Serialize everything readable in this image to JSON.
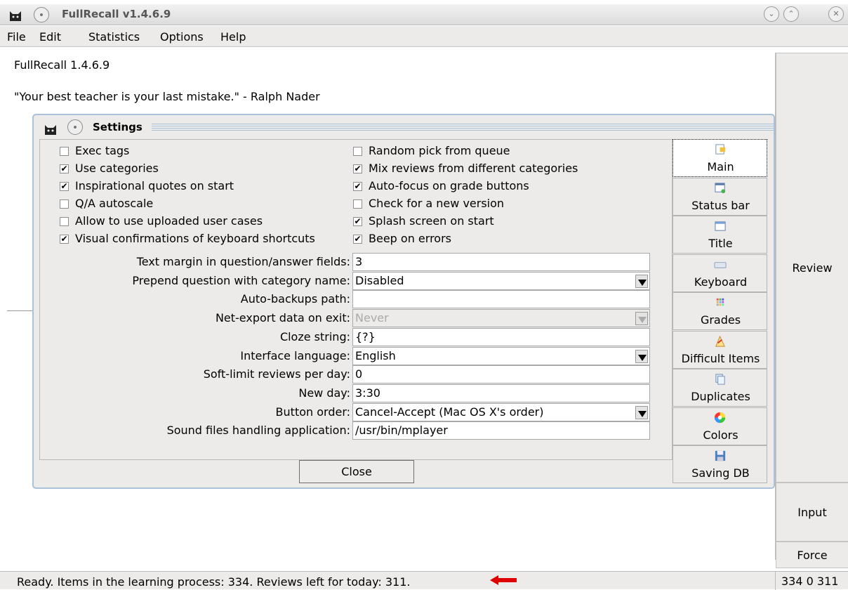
{
  "window": {
    "title": "FullRecall v1.4.6.9"
  },
  "menu": [
    "File",
    "Edit",
    "Statistics",
    "Options",
    "Help"
  ],
  "main": {
    "version_line": "FullRecall 1.4.6.9",
    "quote": "\"Your best teacher is your last mistake.\" - Ralph Nader"
  },
  "right_panel": {
    "review": "Review",
    "input": "Input",
    "force": "Force"
  },
  "status": {
    "text": "Ready. Items in the learning process: 334. Reviews left for today: 311.",
    "counts": "334 0 311",
    "arrow_color": "#e00000"
  },
  "settings": {
    "title": "Settings",
    "checkboxes_left": [
      {
        "label": "Exec tags",
        "checked": false
      },
      {
        "label": "Use categories",
        "checked": true
      },
      {
        "label": "Inspirational quotes on start",
        "checked": true
      },
      {
        "label": "Q/A autoscale",
        "checked": false
      },
      {
        "label": "Allow to use uploaded user cases",
        "checked": false
      },
      {
        "label": "Visual confirmations of keyboard shortcuts",
        "checked": true
      }
    ],
    "checkboxes_right": [
      {
        "label": "Random pick from queue",
        "checked": false
      },
      {
        "label": "Mix reviews from different categories",
        "checked": true
      },
      {
        "label": "Auto-focus on grade buttons",
        "checked": true
      },
      {
        "label": "Check for a new version",
        "checked": false
      },
      {
        "label": "Splash screen on start",
        "checked": true
      },
      {
        "label": "Beep on errors",
        "checked": true
      }
    ],
    "fields": [
      {
        "label": "Text margin in question/answer fields:",
        "value": "3",
        "type": "text"
      },
      {
        "label": "Prepend question with category name:",
        "value": "Disabled",
        "type": "dropdown"
      },
      {
        "label": "Auto-backups path:",
        "value": "",
        "type": "text"
      },
      {
        "label": "Net-export data on exit:",
        "value": "Never",
        "type": "dropdown-disabled"
      },
      {
        "label": "Cloze string:",
        "value": "{?}",
        "type": "text"
      },
      {
        "label": "Interface language:",
        "value": "English",
        "type": "dropdown"
      },
      {
        "label": "Soft-limit reviews per day:",
        "value": "0",
        "type": "text"
      },
      {
        "label": "New day:",
        "value": "3:30",
        "type": "text"
      },
      {
        "label": "Button order:",
        "value": "Cancel-Accept (Mac OS X's order)",
        "type": "dropdown"
      },
      {
        "label": "Sound files handling application:",
        "value": "/usr/bin/mplayer",
        "type": "text"
      }
    ],
    "close": "Close",
    "tabs": [
      {
        "label": "Main",
        "icon": "main-icon",
        "active": true
      },
      {
        "label": "Status bar",
        "icon": "status-bar-icon"
      },
      {
        "label": "Title",
        "icon": "title-window-icon"
      },
      {
        "label": "Keyboard",
        "icon": "keyboard-icon"
      },
      {
        "label": "Grades",
        "icon": "grades-icon"
      },
      {
        "label": "Difficult Items",
        "icon": "difficult-items-icon"
      },
      {
        "label": "Duplicates",
        "icon": "duplicates-icon"
      },
      {
        "label": "Colors",
        "icon": "colors-wheel-icon"
      },
      {
        "label": "Saving DB",
        "icon": "floppy-disk-icon"
      }
    ]
  }
}
